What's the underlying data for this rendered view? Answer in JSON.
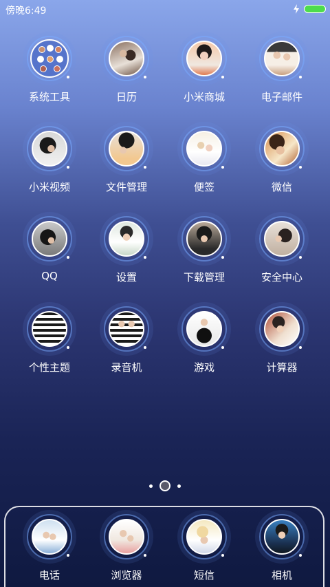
{
  "status_bar": {
    "time": "傍晚6:49",
    "battery_color": "#4ddc4d"
  },
  "home": {
    "apps": [
      {
        "label": "系统工具",
        "icon": "folder-icon"
      },
      {
        "label": "日历",
        "icon": "calendar-photo-icon"
      },
      {
        "label": "小米商城",
        "icon": "store-photo-icon"
      },
      {
        "label": "电子邮件",
        "icon": "email-photo-icon"
      },
      {
        "label": "小米视频",
        "icon": "video-photo-icon"
      },
      {
        "label": "文件管理",
        "icon": "files-photo-icon"
      },
      {
        "label": "便签",
        "icon": "notes-photo-icon"
      },
      {
        "label": "微信",
        "icon": "wechat-photo-icon"
      },
      {
        "label": "QQ",
        "icon": "qq-photo-icon"
      },
      {
        "label": "设置",
        "icon": "settings-photo-icon"
      },
      {
        "label": "下载管理",
        "icon": "download-photo-icon"
      },
      {
        "label": "安全中心",
        "icon": "security-photo-icon"
      },
      {
        "label": "个性主题",
        "icon": "themes-photo-icon"
      },
      {
        "label": "录音机",
        "icon": "recorder-photo-icon"
      },
      {
        "label": "游戏",
        "icon": "games-photo-icon"
      },
      {
        "label": "计算器",
        "icon": "calculator-photo-icon"
      }
    ]
  },
  "dock": {
    "apps": [
      {
        "label": "电话",
        "icon": "phone-photo-icon"
      },
      {
        "label": "浏览器",
        "icon": "browser-photo-icon"
      },
      {
        "label": "短信",
        "icon": "sms-photo-icon"
      },
      {
        "label": "相机",
        "icon": "camera-photo-icon"
      }
    ]
  },
  "colors": {
    "ring": "#78aaff",
    "label": "#ffffff"
  }
}
